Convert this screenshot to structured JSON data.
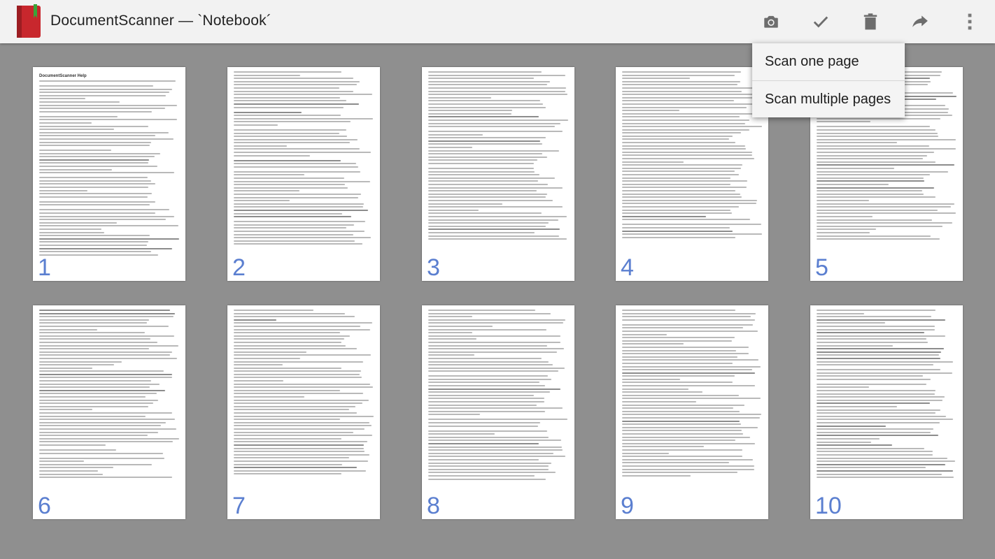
{
  "app": {
    "title": "DocumentScanner — `Notebook´",
    "brand_color": "#c8272d",
    "icon": "red-notebook-icon"
  },
  "toolbar": {
    "actions": [
      {
        "name": "camera",
        "icon": "camera-icon"
      },
      {
        "name": "select",
        "icon": "checkmark-icon"
      },
      {
        "name": "delete",
        "icon": "trash-icon"
      },
      {
        "name": "share",
        "icon": "share-icon"
      },
      {
        "name": "overflow",
        "icon": "overflow-menu-icon"
      }
    ]
  },
  "menu": {
    "items": [
      "Scan one page",
      "Scan multiple pages"
    ]
  },
  "pages": [
    {
      "number": "1",
      "heading": "DocumentScanner Help"
    },
    {
      "number": "2",
      "heading": ""
    },
    {
      "number": "3",
      "heading": ""
    },
    {
      "number": "4",
      "heading": ""
    },
    {
      "number": "5",
      "heading": ""
    },
    {
      "number": "6",
      "heading": ""
    },
    {
      "number": "7",
      "heading": ""
    },
    {
      "number": "8",
      "heading": ""
    },
    {
      "number": "9",
      "heading": ""
    },
    {
      "number": "10",
      "heading": ""
    }
  ],
  "colors": {
    "background": "#8f8f8f",
    "actionbar": "#f2f2f2",
    "page_number": "#5b7fd0"
  }
}
